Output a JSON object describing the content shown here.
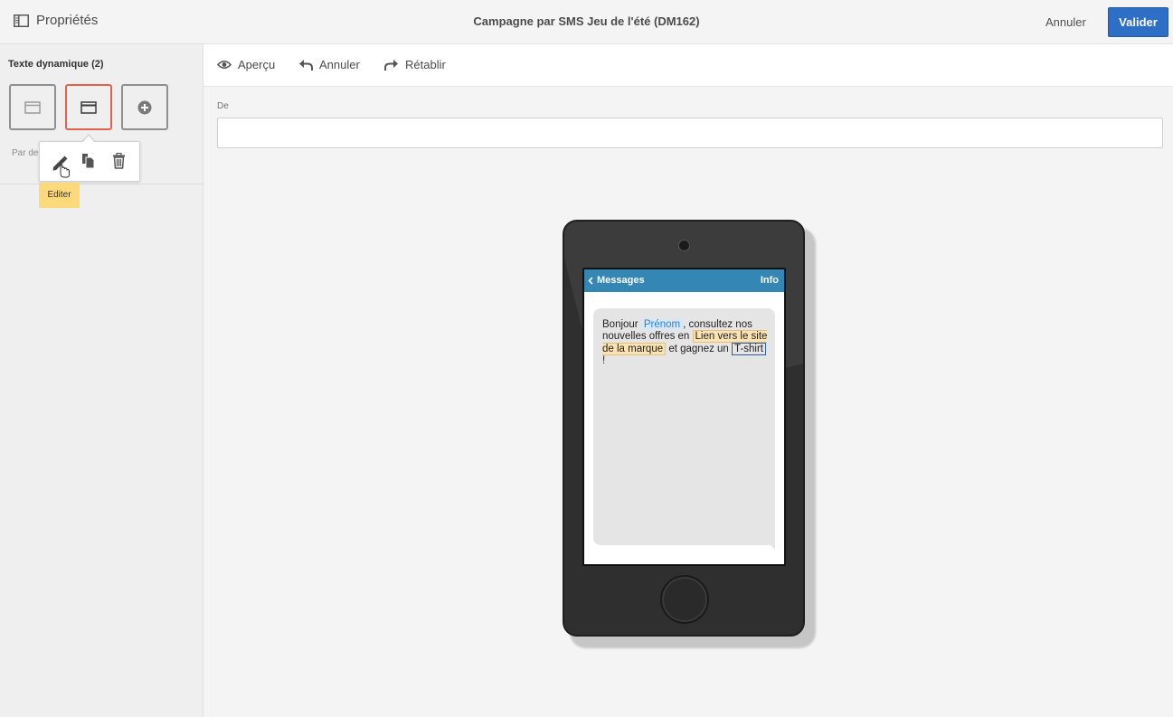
{
  "topbar": {
    "properties_label": "Propriétés",
    "title": "Campagne par SMS Jeu de l'été (DM162)",
    "cancel_label": "Annuler",
    "validate_label": "Valider",
    "validate_color": "#2d6ec6"
  },
  "left_panel": {
    "dynamic_text_title": "Texte dynamique (2)",
    "sub_label_partial": "Par de",
    "tiles": [
      {
        "icon": "content-block-icon",
        "selected": false
      },
      {
        "icon": "content-block-icon",
        "selected": true
      },
      {
        "icon": "add-circle-icon",
        "selected": false
      }
    ],
    "selected_color": "#e2614d",
    "popover": {
      "actions": [
        "edit-icon",
        "duplicate-icon",
        "delete-icon"
      ],
      "tooltip": "Editer"
    }
  },
  "toolbar": {
    "preview_label": "Aperçu",
    "undo_label": "Annuler",
    "redo_label": "Rétablir"
  },
  "form": {
    "from_label": "De",
    "from_value": ""
  },
  "sms_preview": {
    "header_back": "Messages",
    "header_info": "Info",
    "header_color": "#3487b5",
    "message": {
      "part1": "Bonjour ",
      "personalization_first_name": "Prénom",
      "part2": ", consultez nos nouvelles offres en ",
      "link_tag": "Lien vers le site de la marque",
      "part3": " et gagnez un ",
      "product_tag": "T-shirt",
      "part4": " !"
    }
  }
}
